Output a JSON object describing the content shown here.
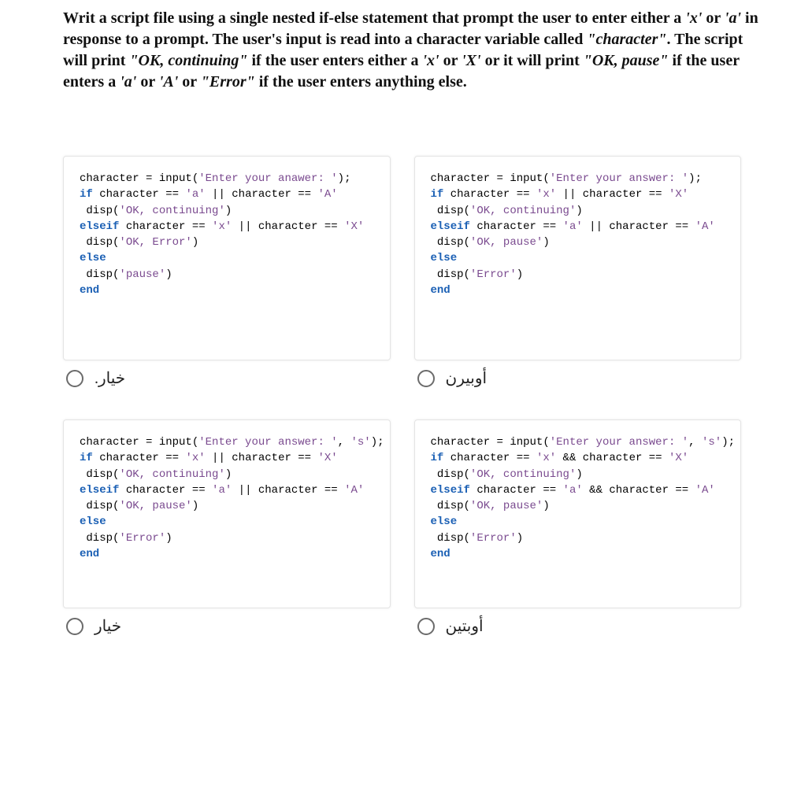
{
  "question": {
    "lead": "Writ a script file using a single nested if-else statement that prompt the user to enter either a ",
    "tok_x": "'x'",
    "or1": " or ",
    "tok_a": "'a'",
    "inresp": " in  response to a prompt. The user's input is read into a character  variable called ",
    "charq": "\"character\"",
    "after_char": ". The script will print ",
    "okcont": "\"OK, continuing\"",
    "ifuser": " if the  user enters either a ",
    "tok_x2": "'x'",
    "or2": " or ",
    "tok_X": "'X'",
    "orprint": " or it will print ",
    "okpause": "\"OK, pause\"",
    "ifuser2": " if the user  enters a ",
    "tok_a2": "'a'",
    "or3": " or ",
    "tok_A": "'A'",
    "or4": " or ",
    "errq": "\"Error\"",
    "tail": " if the user enters anything else."
  },
  "options": [
    {
      "label": "خيار.",
      "code": {
        "l1_a": "character = input(",
        "l1_b": "'Enter your anawer: '",
        "l1_c": ");",
        "l2_a": "if",
        "l2_b": " character == ",
        "l2_c": "'a'",
        "l2_d": " || character == ",
        "l2_e": "'A'",
        "l3_a": " disp(",
        "l3_b": "'OK, continuing'",
        "l3_c": ")",
        "l4_a": "elseif",
        "l4_b": " character == ",
        "l4_c": "'x'",
        "l4_d": " || character == ",
        "l4_e": "'X'",
        "l5_a": " disp(",
        "l5_b": "'OK, Error'",
        "l5_c": ")",
        "l6_a": "else",
        "l7_a": " disp(",
        "l7_b": "'pause'",
        "l7_c": ")",
        "l8_a": "end"
      }
    },
    {
      "label": "أوبيرن",
      "code": {
        "l1_a": "character = input(",
        "l1_b": "'Enter your answer: '",
        "l1_c": ");",
        "l2_a": "if",
        "l2_b": " character == ",
        "l2_c": "'x'",
        "l2_d": " || character == ",
        "l2_e": "'X'",
        "l3_a": " disp(",
        "l3_b": "'OK, continuing'",
        "l3_c": ")",
        "l4_a": "elseif",
        "l4_b": " character == ",
        "l4_c": "'a'",
        "l4_d": " || character == ",
        "l4_e": "'A'",
        "l5_a": " disp(",
        "l5_b": "'OK, pause'",
        "l5_c": ")",
        "l6_a": "else",
        "l7_a": " disp(",
        "l7_b": "'Error'",
        "l7_c": ")",
        "l8_a": "end"
      }
    },
    {
      "label": "خيار",
      "code": {
        "l1_a": "character = input(",
        "l1_b": "'Enter your answer: '",
        "l1_c": ", ",
        "l1_d": "'s'",
        "l1_e": ");",
        "l2_a": "if",
        "l2_b": " character == ",
        "l2_c": "'x'",
        "l2_d": " || character == ",
        "l2_e": "'X'",
        "l3_a": " disp(",
        "l3_b": "'OK, continuing'",
        "l3_c": ")",
        "l4_a": "elseif",
        "l4_b": " character == ",
        "l4_c": "'a'",
        "l4_d": " || character == ",
        "l4_e": "'A'",
        "l5_a": " disp(",
        "l5_b": "'OK, pause'",
        "l5_c": ")",
        "l6_a": "else",
        "l7_a": " disp(",
        "l7_b": "'Error'",
        "l7_c": ")",
        "l8_a": "end"
      }
    },
    {
      "label": "أوبتين",
      "code": {
        "l1_a": "character = input(",
        "l1_b": "'Enter your answer: '",
        "l1_c": ", ",
        "l1_d": "'s'",
        "l1_e": ");",
        "l2_a": "if",
        "l2_b": " character == ",
        "l2_c": "'x'",
        "l2_d": " && character == ",
        "l2_e": "'X'",
        "l3_a": " disp(",
        "l3_b": "'OK, continuing'",
        "l3_c": ")",
        "l4_a": "elseif",
        "l4_b": " character == ",
        "l4_c": "'a'",
        "l4_d": " && character == ",
        "l4_e": "'A'",
        "l5_a": " disp(",
        "l5_b": "'OK, pause'",
        "l5_c": ")",
        "l6_a": "else",
        "l7_a": " disp(",
        "l7_b": "'Error'",
        "l7_c": ")",
        "l8_a": "end"
      }
    }
  ]
}
